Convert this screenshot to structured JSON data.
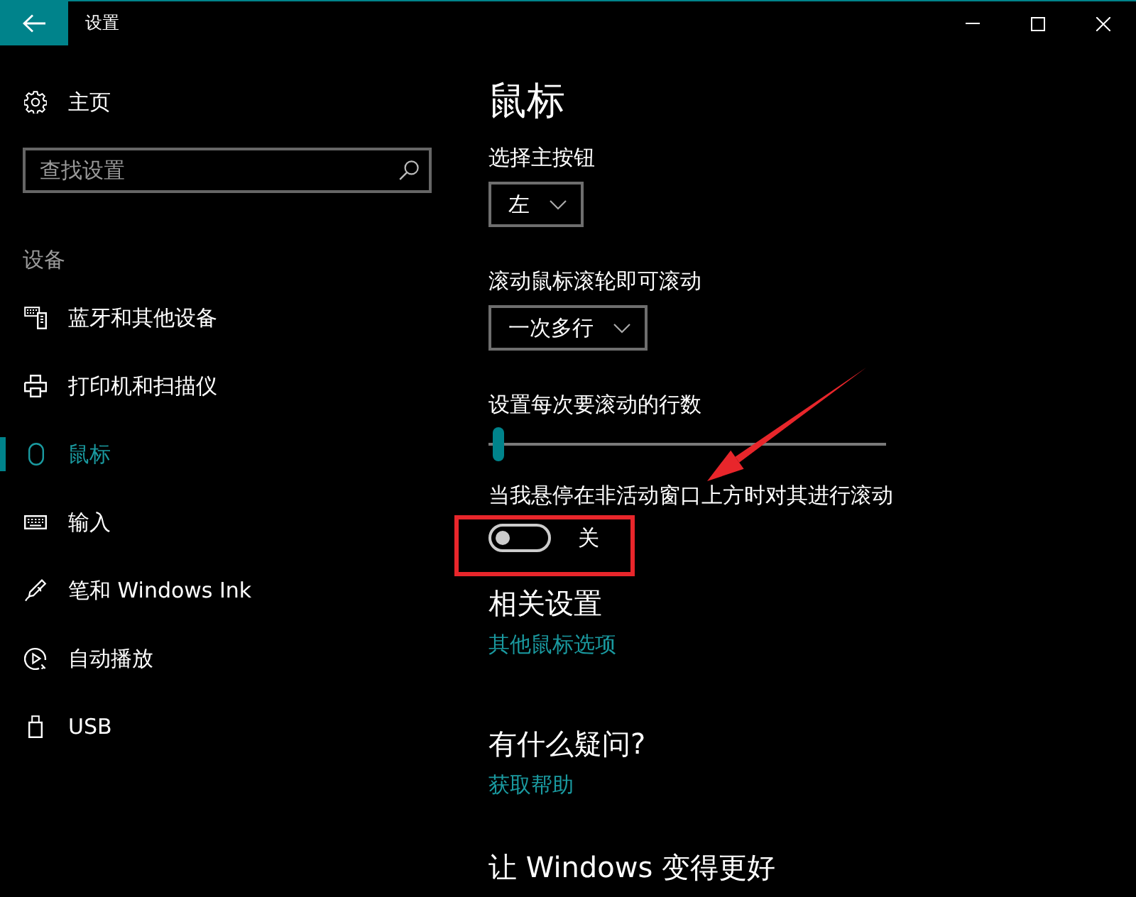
{
  "window": {
    "title": "设置"
  },
  "sidebar": {
    "home": {
      "label": "主页"
    },
    "search": {
      "placeholder": "查找设置"
    },
    "section_title": "设备",
    "items": [
      {
        "label": "蓝牙和其他设备",
        "selected": false
      },
      {
        "label": "打印机和扫描仪",
        "selected": false
      },
      {
        "label": "鼠标",
        "selected": true
      },
      {
        "label": "输入",
        "selected": false
      },
      {
        "label": "笔和 Windows Ink",
        "selected": false
      },
      {
        "label": "自动播放",
        "selected": false
      },
      {
        "label": "USB",
        "selected": false
      }
    ]
  },
  "content": {
    "title": "鼠标",
    "settings": [
      {
        "kind": "dropdown",
        "label": "选择主按钮",
        "value": "左"
      },
      {
        "kind": "dropdown",
        "label": "滚动鼠标滚轮即可滚动",
        "value": "一次多行"
      },
      {
        "kind": "slider",
        "label": "设置每次要滚动的行数",
        "level": 0.01
      },
      {
        "kind": "toggle",
        "label": "当我悬停在非活动窗口上方时对其进行滚动",
        "on": false,
        "state_text": "关"
      }
    ],
    "sections": [
      {
        "heading": "相关设置",
        "links": [
          "其他鼠标选项"
        ]
      },
      {
        "heading": "有什么疑问?",
        "links": [
          "获取帮助"
        ]
      },
      {
        "heading": "让 Windows 变得更好"
      }
    ]
  }
}
